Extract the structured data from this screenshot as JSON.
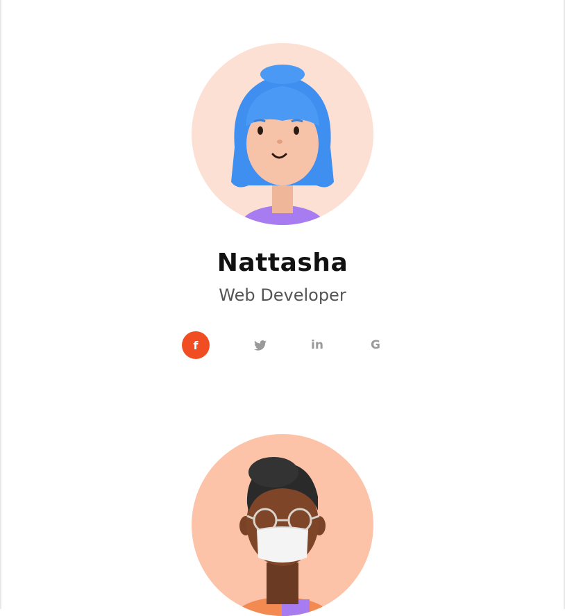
{
  "members": [
    {
      "name": "Nattasha",
      "role": "Web Developer",
      "avatar_bg": "#fde0d4",
      "socials": [
        {
          "icon": "facebook-icon",
          "glyph": "f",
          "active": true
        },
        {
          "icon": "twitter-icon",
          "glyph": "🐦",
          "active": false
        },
        {
          "icon": "linkedin-icon",
          "glyph": "in",
          "active": false
        },
        {
          "icon": "google-icon",
          "glyph": "G",
          "active": false
        }
      ]
    },
    {
      "avatar_bg": "#fcc3a8"
    }
  ],
  "colors": {
    "accent": "#f04d23",
    "icon_muted": "#9a9a9a",
    "name_text": "#111111",
    "role_text": "#555555"
  }
}
